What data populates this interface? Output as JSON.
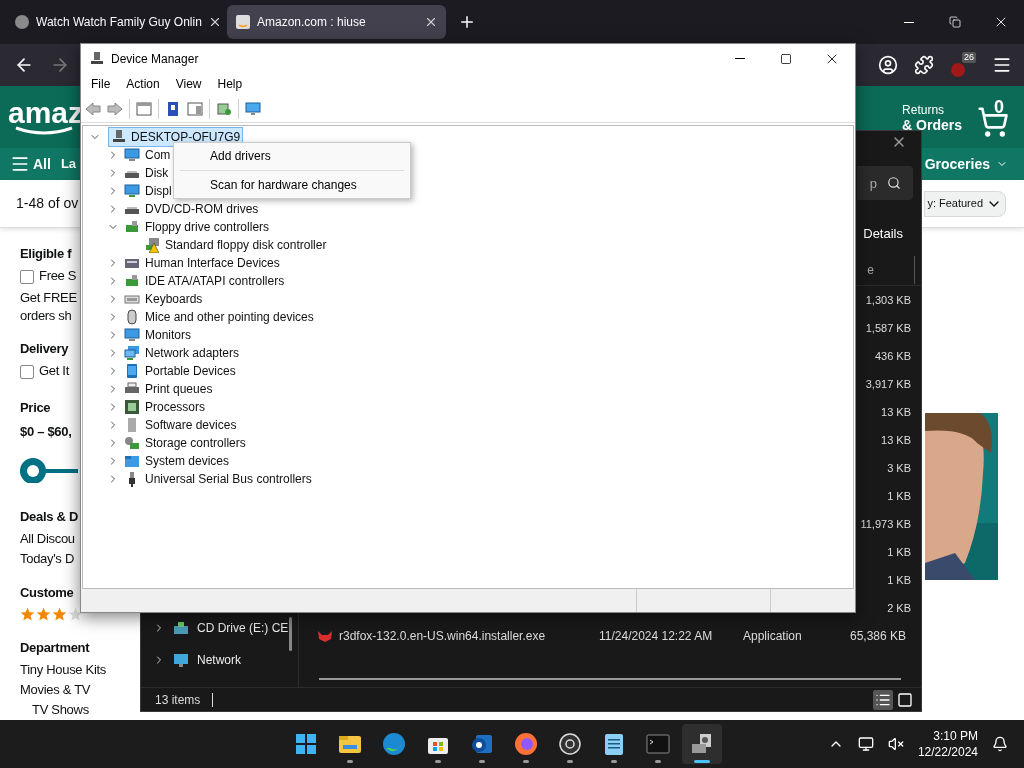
{
  "browser": {
    "tabs": [
      {
        "title": "Watch Watch Family Guy Onlin",
        "selected": false
      },
      {
        "title": "Amazon.com : hiuse",
        "selected": true
      }
    ],
    "forward": {
      "disabled": true
    },
    "extension_badge": "26"
  },
  "amazon": {
    "logo": "amaz",
    "returns": "Returns",
    "orders": "& Orders",
    "cart_count": "0",
    "nav_all": "All",
    "nav_item": "La",
    "nav_groceries": "Groceries",
    "results": "1-48 of ov",
    "sort": {
      "label": "y:",
      "value": "Featured"
    },
    "sidebar": [
      {
        "kind": "heading",
        "text": "Eligible f"
      },
      {
        "kind": "checkbox",
        "text": "Free S",
        "checked": false
      },
      {
        "kind": "paragraph",
        "text": "Get FREE orders sh"
      },
      {
        "kind": "heading",
        "text": "Delivery"
      },
      {
        "kind": "checkbox",
        "text": "Get It",
        "checked": false
      },
      {
        "kind": "heading",
        "text": "Price"
      },
      {
        "kind": "price",
        "text": "$0 – $60,"
      },
      {
        "kind": "slider",
        "level": 1
      },
      {
        "kind": "heading",
        "text": "Deals & D"
      },
      {
        "kind": "text",
        "text": "All Discou"
      },
      {
        "kind": "text",
        "text": "Today's D"
      },
      {
        "kind": "heading",
        "text": "Custome"
      },
      {
        "kind": "stars",
        "stars": 3
      },
      {
        "kind": "heading",
        "text": "Department"
      },
      {
        "kind": "text",
        "text": "Tiny House Kits"
      },
      {
        "kind": "text",
        "text": "Movies & TV"
      },
      {
        "kind": "subtext",
        "text": "TV Shows"
      }
    ]
  },
  "explorer": {
    "search_placeholder": "p",
    "view_button": "Details",
    "column_header": "e",
    "sizes": [
      "1,303 KB",
      "1,587 KB",
      "436 KB",
      "3,917 KB",
      "13 KB",
      "13 KB",
      "3 KB",
      "1 KB",
      "11,973 KB",
      "1 KB",
      "1 KB",
      "2 KB"
    ],
    "file": {
      "name": "r3dfox-132.0.en-US.win64.installer.exe",
      "date": "11/24/2024 12:22 AM",
      "type": "Application",
      "size": "65,386 KB"
    },
    "nav": [
      {
        "label": "CD Drive (E:) CE"
      },
      {
        "label": "Network"
      }
    ],
    "status": "13 items",
    "views": [
      {
        "selected": true
      },
      {
        "selected": false
      }
    ]
  },
  "device_manager": {
    "title": "Device Manager",
    "menu": [
      "File",
      "Action",
      "View",
      "Help"
    ],
    "tree": {
      "label": "DESKTOP-OFU7G9",
      "expanded": true,
      "selected": true,
      "children": [
        {
          "label": "Com",
          "expanded": false
        },
        {
          "label": "Disk",
          "expanded": false
        },
        {
          "label": "Displ",
          "expanded": false
        },
        {
          "label": "DVD/CD-ROM drives",
          "expanded": false
        },
        {
          "label": "Floppy drive controllers",
          "expanded": true,
          "children": [
            {
              "label": "Standard floppy disk controller",
              "warning": true
            }
          ]
        },
        {
          "label": "Human Interface Devices",
          "expanded": false
        },
        {
          "label": "IDE ATA/ATAPI controllers",
          "expanded": false
        },
        {
          "label": "Keyboards",
          "expanded": false
        },
        {
          "label": "Mice and other pointing devices",
          "expanded": false
        },
        {
          "label": "Monitors",
          "expanded": false
        },
        {
          "label": "Network adapters",
          "expanded": false
        },
        {
          "label": "Portable Devices",
          "expanded": false
        },
        {
          "label": "Print queues",
          "expanded": false
        },
        {
          "label": "Processors",
          "expanded": false
        },
        {
          "label": "Software devices",
          "expanded": false
        },
        {
          "label": "Storage controllers",
          "expanded": false
        },
        {
          "label": "System devices",
          "expanded": false
        },
        {
          "label": "Universal Serial Bus controllers",
          "expanded": false
        }
      ]
    },
    "context_menu": [
      "Add drivers",
      "Scan for hardware changes"
    ]
  },
  "taskbar": {
    "apps": [
      {
        "running": false,
        "selected": false
      },
      {
        "running": true,
        "selected": false
      },
      {
        "running": false,
        "selected": false
      },
      {
        "running": true,
        "selected": false
      },
      {
        "running": true,
        "selected": false
      },
      {
        "running": true,
        "selected": false
      },
      {
        "running": true,
        "selected": false
      },
      {
        "running": true,
        "selected": false
      },
      {
        "running": true,
        "selected": false
      },
      {
        "running": true,
        "selected": true
      }
    ],
    "time": "3:10 PM",
    "date": "12/22/2024"
  }
}
